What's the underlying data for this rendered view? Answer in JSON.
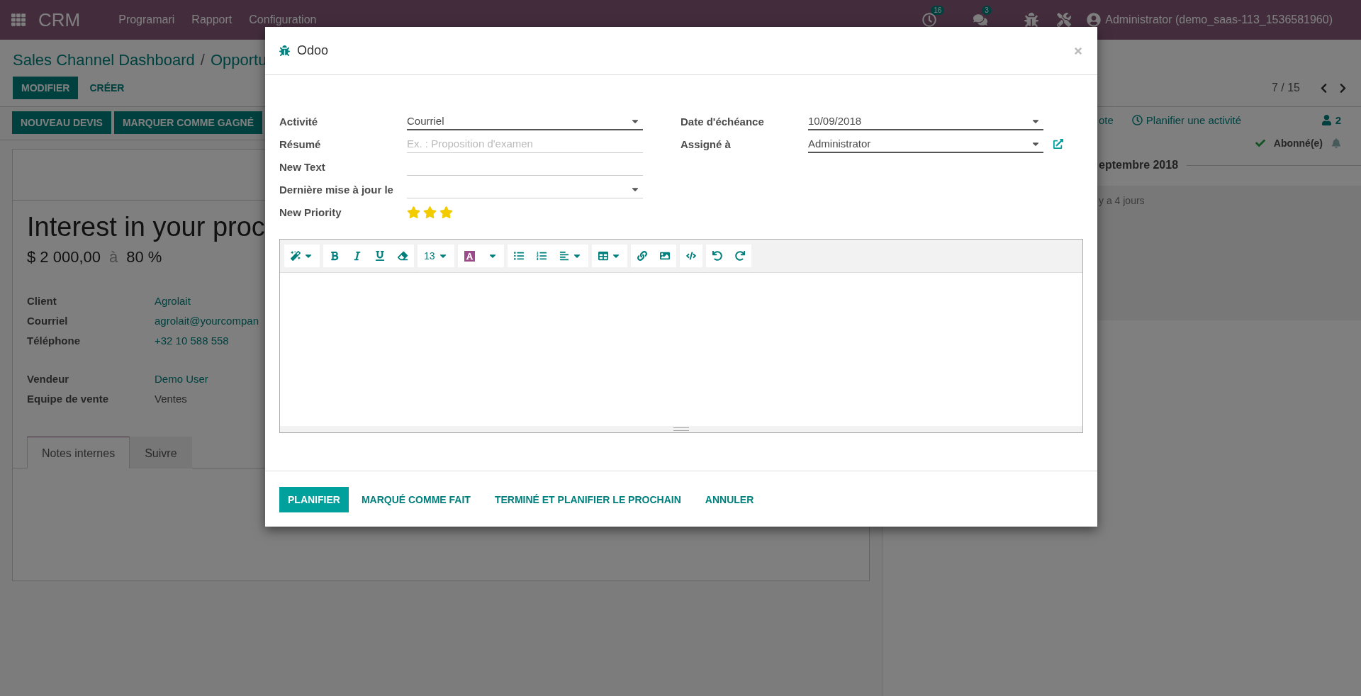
{
  "navbar": {
    "app": "CRM",
    "menus": [
      "Programari",
      "Rapport",
      "Configuration"
    ],
    "activity_count": "16",
    "message_count": "3",
    "user": "Administrator (demo_saas-113_1536581960)"
  },
  "control_panel": {
    "breadcrumb": [
      "Sales Channel Dashboard",
      "Opportu"
    ],
    "separator": "/",
    "buttons": [
      {
        "label": "MODIFIER",
        "kind": "primary"
      },
      {
        "label": "CRÉER",
        "kind": "link"
      }
    ],
    "pager": "7 / 15"
  },
  "statusbar_buttons": [
    "NOUVEAU DEVIS",
    "MARQUER COMME GAGNÉ"
  ],
  "form": {
    "title": "Interest in your proc",
    "revenue": "$ 2 000,00",
    "at": "à",
    "probability": "80 %",
    "groups": [
      [
        {
          "label": "Client",
          "value": "Agrolait",
          "kind": "link"
        },
        {
          "label": "Courriel",
          "value": "agrolait@yourcompan",
          "kind": "link"
        },
        {
          "label": "Téléphone",
          "value": "+32 10 588 558",
          "kind": "link"
        }
      ],
      [
        {
          "label": "Vendeur",
          "value": "Demo User",
          "kind": "link"
        },
        {
          "label": "Equipe de vente",
          "value": "Ventes",
          "kind": "text"
        }
      ]
    ],
    "tabs": [
      {
        "label": "Notes internes",
        "selected": true
      },
      {
        "label": "Suivre",
        "selected": false
      }
    ]
  },
  "chatter": {
    "actions": [
      "ote",
      "Planifier une activité"
    ],
    "followers": "2",
    "subscription": "Abonné(e)",
    "date_separator": "eptembre 2018",
    "message_time": "y a 4 jours"
  },
  "dialog": {
    "title": "Odoo",
    "left_fields": [
      {
        "label": "Activité",
        "kind": "select",
        "value": "Courriel",
        "required": true
      },
      {
        "label": "Résumé",
        "kind": "text",
        "placeholder": "Ex. : Proposition d'examen",
        "required": false
      },
      {
        "label": "New Text",
        "kind": "text",
        "required": false
      },
      {
        "label": "Dernière mise à jour le",
        "kind": "select",
        "required": false
      },
      {
        "label": "New Priority",
        "kind": "priority",
        "stars": 3
      }
    ],
    "right_fields": [
      {
        "label": "Date d'échéance",
        "kind": "select",
        "value": "10/09/2018",
        "required": true
      },
      {
        "label": "Assigné à",
        "kind": "many2one",
        "value": "Administrator",
        "required": true
      }
    ],
    "font_size": "13",
    "buttons": [
      {
        "label": "PLANIFIER",
        "kind": "primary"
      },
      {
        "label": "MARQUÉ COMME FAIT",
        "kind": "link"
      },
      {
        "label": "TERMINÉ ET PLANIFIER LE PROCHAIN",
        "kind": "link"
      },
      {
        "label": "ANNULER",
        "kind": "link"
      }
    ]
  }
}
